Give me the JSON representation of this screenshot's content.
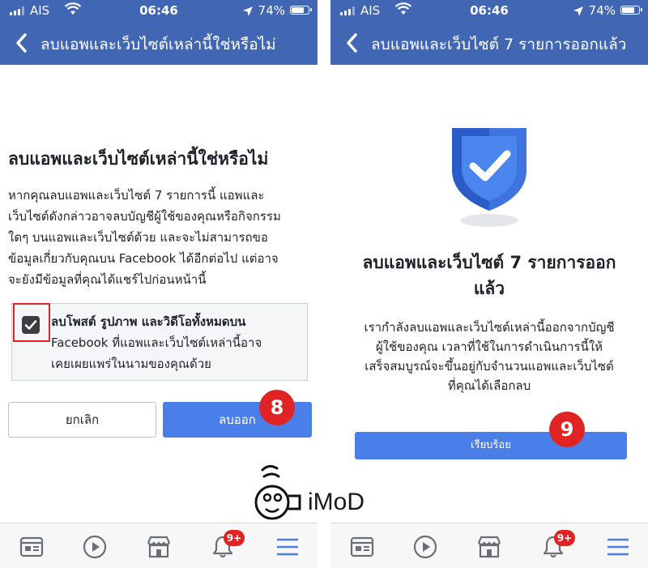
{
  "status_bar": {
    "carrier": "AIS",
    "time": "06:46",
    "battery_pct": "74%",
    "battery_level": 0.74,
    "icons": [
      "signal-icon",
      "wifi-icon",
      "location-arrow-icon",
      "battery-icon"
    ]
  },
  "left": {
    "nav_title": "ลบแอพและเว็บไซต์เหล่านี้ใช่หรือไม่",
    "heading": "ลบแอพและเว็บไซต์เหล่านี้ใช่หรือไม่",
    "body_lines": [
      "หากคุณลบแอพและเว็บไซต์ 7 รายการนี้ แอพและ",
      "เว็บไซต์ดังกล่าวอาจลบบัญชีผู้ใช้ของคุณหรือกิจกรรม",
      "ใดๆ บนแอพและเว็บไซต์ด้วย และจะไม่สามารถขอ",
      "ข้อมูลเกี่ยวกับคุณบน Facebook ได้อีกต่อไป แต่อาจ",
      "จะยังมีข้อมูลที่คุณได้แชร์ไปก่อนหน้านี้"
    ],
    "checkbox": {
      "checked": true,
      "bold_label": "ลบโพสต์ รูปภาพ และวิดีโอทั้งหมดบน",
      "line2": "Facebook ที่แอพและเว็บไซต์เหล่านี้อาจ",
      "line3": "เคยเผยแพร่ในนามของคุณด้วย"
    },
    "cancel_label": "ยกเลิก",
    "delete_label": "ลบออก",
    "step_badge": "8"
  },
  "right": {
    "nav_title": "ลบแอพและเว็บไซต์ 7 รายการออกแล้ว",
    "heading_lines": [
      "ลบแอพและเว็บไซต์ 7 รายการออก",
      "แล้ว"
    ],
    "body_lines": [
      "เรากำลังลบแอพและเว็บไซต์เหล่านี้ออกจากบัญชี",
      "ผู้ใช้ของคุณ เวลาที่ใช้ในการดำเนินการนี้ให้",
      "เสร็จสมบูรณ์จะขึ้นอยู่กับจำนวนแอพและเว็บไซต์",
      "ที่คุณได้เลือกลบ"
    ],
    "done_label": "เรียบร้อย",
    "step_badge": "9"
  },
  "tab_bar": {
    "tabs": [
      "news-feed-icon",
      "watch-play-icon",
      "marketplace-icon",
      "notifications-bell-icon",
      "menu-icon"
    ],
    "notification_badge": "9+"
  },
  "watermark": "iMoD",
  "colors": {
    "header_blue": "#4166b3",
    "button_blue": "#4a7ee8",
    "badge_red": "#e02424"
  }
}
